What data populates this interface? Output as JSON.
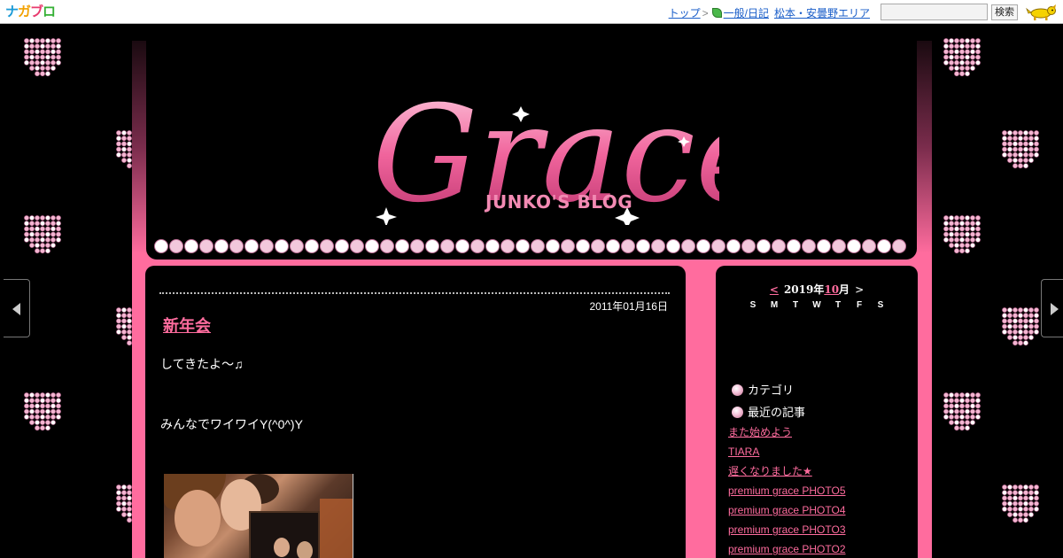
{
  "topbar": {
    "logo_text": "ナガブロ",
    "nav_top": "トップ",
    "nav_sep": ">",
    "nav_category": "一般/日記",
    "nav_area": "松本・安曇野エリア",
    "search_button": "検索",
    "search_placeholder": ""
  },
  "header": {
    "title": "Grace",
    "subtitle": "JUNKO'S BLOG"
  },
  "entry": {
    "date": "2011年01月16日",
    "title": "新年会",
    "line1": "してきたよ〜♫",
    "line2": "みんなでワイワイY(^0^)Y"
  },
  "calendar": {
    "prev": "<",
    "year_label": "2019年",
    "month": "10",
    "month_suffix": "月",
    "next": ">",
    "weekdays": [
      "S",
      "M",
      "T",
      "W",
      "T",
      "F",
      "S"
    ]
  },
  "sidebar": {
    "category_heading": "カテゴリ",
    "recent_heading": "最近の記事",
    "recent": [
      "また始めよう",
      "TIARA",
      "遅くなりました★",
      "premium grace PHOTO5",
      "premium grace PHOTO4",
      "premium grace PHOTO3",
      "premium grace PHOTO2"
    ]
  },
  "colors": {
    "accent": "#ff6c9e",
    "background": "#000000",
    "link_blue": "#1a5ec9"
  },
  "icons": {
    "heart": "rhinestone-heart-icon",
    "bullet": "gem-bullet-icon",
    "mascot": "yellow-dog-mascot-icon"
  }
}
